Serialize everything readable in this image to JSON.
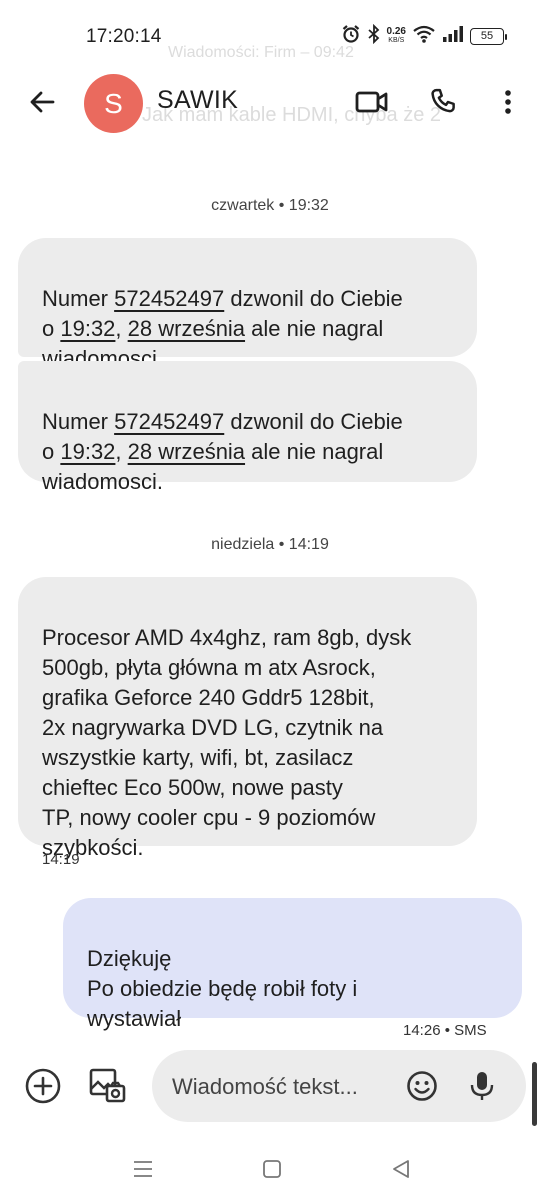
{
  "status_bar": {
    "time": "17:20:14",
    "net_speed_value": "0.26",
    "net_speed_unit": "KB/S",
    "battery": "55",
    "icons": [
      "alarm-icon",
      "bluetooth-icon",
      "wifi-icon",
      "signal-icon",
      "battery-icon"
    ]
  },
  "background_ghost": {
    "line1": "Wiadomości: Firm – 09:42",
    "line2": "Jak mam kable HDMI, chyba że 2"
  },
  "header": {
    "avatar_letter": "S",
    "avatar_color": "#ea6a5e",
    "contact_name": "SAWIK",
    "actions": [
      "back-arrow-icon",
      "video-call-icon",
      "phone-icon",
      "more-vert-icon"
    ]
  },
  "conversation": {
    "separator1": "czwartek • 19:32",
    "msg1": {
      "p1": "Numer ",
      "link1": "572452497",
      "p2": " dzwonil do Ciebie\no ",
      "link2": "19:32",
      "p3": ", ",
      "link3": "28 września",
      "p4": " ale nie nagral\nwiadomosci."
    },
    "msg2": {
      "p1": "Numer ",
      "link1": "572452497",
      "p2": " dzwonil do Ciebie\no ",
      "link2": "19:32",
      "p3": ", ",
      "link3": "28 września",
      "p4": " ale nie nagral\nwiadomosci."
    },
    "separator2": "niedziela • 14:19",
    "msg3": {
      "text": "Procesor AMD 4x4ghz, ram 8gb, dysk\n500gb, płyta główna m atx Asrock,\ngrafika Geforce 240 Gddr5 128bit,\n2x nagrywarka DVD LG, czytnik na\nwszystkie karty, wifi, bt, zasilacz\nchieftec Eco 500w, nowe pasty\nTP, nowy cooler cpu - 9 poziomów\nszybkości.",
      "time": "14:19"
    },
    "msg4": {
      "text": "Dziękuję\nPo obiedzie będę robił foty i\nwystawiał",
      "meta": "14:26 • SMS"
    }
  },
  "compose": {
    "placeholder": "Wiadomość tekst...",
    "buttons": [
      "add-icon",
      "gallery-icon",
      "emoji-icon",
      "mic-icon"
    ]
  },
  "nav_bar": {
    "buttons": [
      "recents-icon",
      "home-icon",
      "back-icon"
    ]
  },
  "colors": {
    "incoming_bubble": "#ececec",
    "outgoing_bubble": "#dfe3f8",
    "avatar": "#ea6a5e"
  }
}
